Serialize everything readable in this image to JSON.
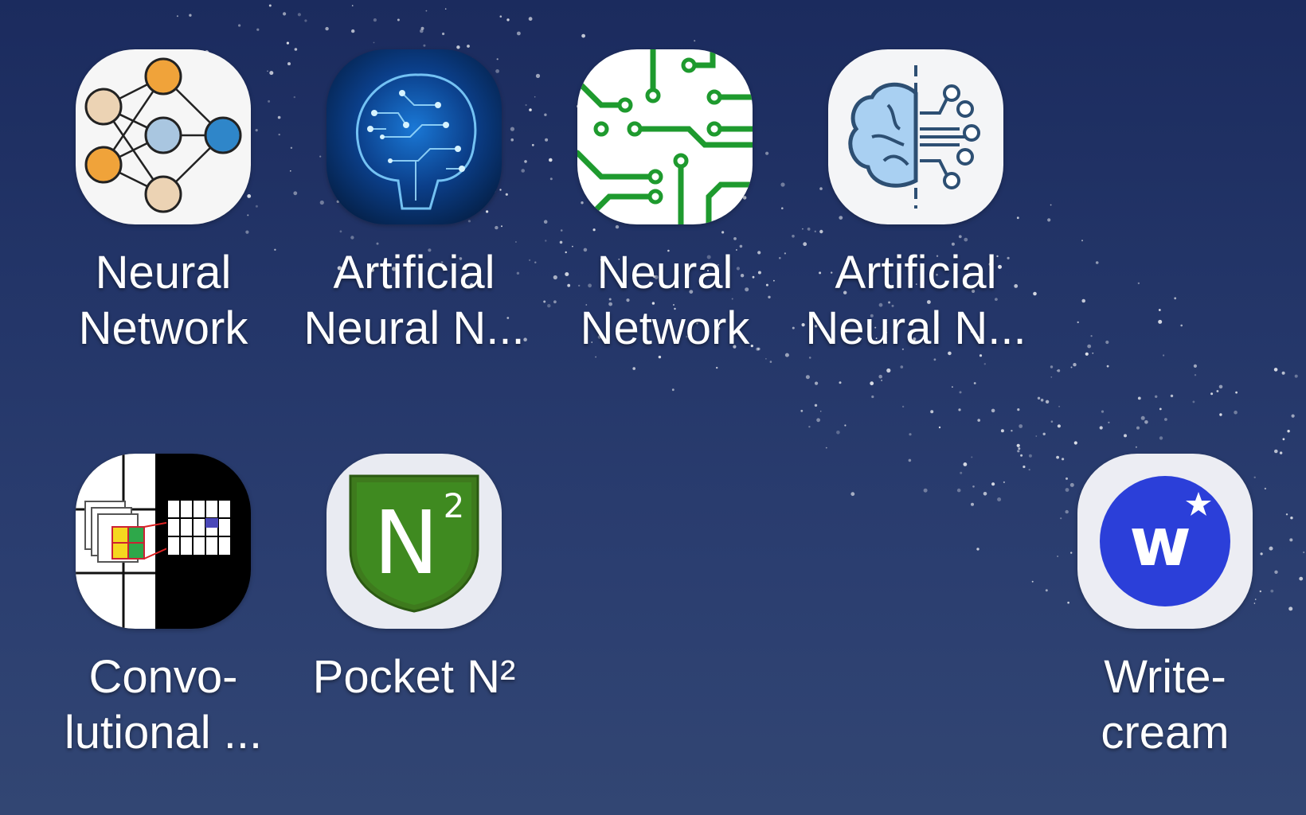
{
  "home_screen": {
    "apps": [
      {
        "name_line1": "Neural",
        "name_line2": "Network",
        "icon": "neural-network-graph-icon"
      },
      {
        "name_line1": "Artificial",
        "name_line2": "Neural N...",
        "icon": "circuit-brain-icon"
      },
      {
        "name_line1": "Neural",
        "name_line2": "Network",
        "icon": "green-circuit-icon"
      },
      {
        "name_line1": "Artificial",
        "name_line2": "Neural N...",
        "icon": "brain-circuit-split-icon"
      },
      {
        "name_line1": "Convo-",
        "name_line2": "lutional ...",
        "icon": "convolution-grid-icon"
      },
      {
        "name_line1": "Pocket N²",
        "name_line2": "",
        "icon": "n-squared-shield-icon"
      },
      {
        "name_line1": "Write-",
        "name_line2": "cream",
        "icon": "writecream-w-icon"
      }
    ]
  },
  "colors": {
    "wallpaper_top": "#1b2b5e",
    "wallpaper_bottom": "#324673",
    "label_text": "#ffffff"
  }
}
